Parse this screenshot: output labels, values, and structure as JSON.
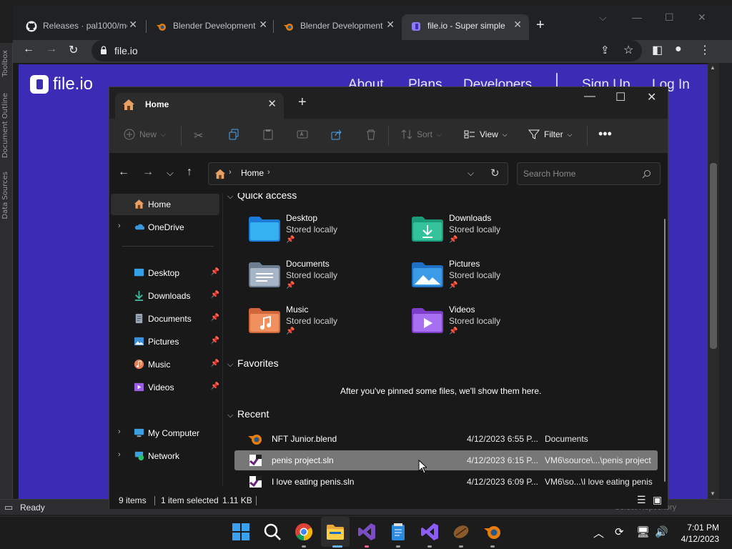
{
  "chrome": {
    "tabs": [
      {
        "title": "Releases · pal1000/me",
        "icon": "github-icon"
      },
      {
        "title": "Blender Development",
        "icon": "blender-icon"
      },
      {
        "title": "Blender Development",
        "icon": "blender-icon"
      },
      {
        "title": "file.io - Super simple",
        "icon": "fileio-icon",
        "active": true
      }
    ],
    "url": "file.io"
  },
  "fileio": {
    "brand": "file.io",
    "nav": [
      "About",
      "Plans",
      "Developers",
      "Sign Up",
      "Log In"
    ],
    "brand_color": "#3b2bb5"
  },
  "vs": {
    "side_labels": [
      "Toolbox",
      "Document Outline",
      "Data Sources"
    ],
    "status": "Ready",
    "status_right": "Select Repository"
  },
  "explorer": {
    "tab_title": "Home",
    "commands": {
      "new": "New",
      "sort": "Sort",
      "view": "View",
      "filter": "Filter"
    },
    "address": "Home",
    "search_placeholder": "Search Home",
    "nav": {
      "home": "Home",
      "onedrive": "OneDrive",
      "desktop": "Desktop",
      "downloads": "Downloads",
      "documents": "Documents",
      "pictures": "Pictures",
      "music": "Music",
      "videos": "Videos",
      "mycomputer": "My Computer",
      "network": "Network"
    },
    "quick_access_header": "Quick access",
    "quick_access": [
      {
        "name": "Desktop",
        "status": "Stored locally",
        "icon": "desktop-folder-icon"
      },
      {
        "name": "Downloads",
        "status": "Stored locally",
        "icon": "downloads-folder-icon"
      },
      {
        "name": "Documents",
        "status": "Stored locally",
        "icon": "documents-folder-icon"
      },
      {
        "name": "Pictures",
        "status": "Stored locally",
        "icon": "pictures-folder-icon"
      },
      {
        "name": "Music",
        "status": "Stored locally",
        "icon": "music-folder-icon"
      },
      {
        "name": "Videos",
        "status": "Stored locally",
        "icon": "videos-folder-icon"
      }
    ],
    "favorites_header": "Favorites",
    "favorites_empty": "After you've pinned some files, we'll show them here.",
    "recent_header": "Recent",
    "recent": [
      {
        "name": "NFT Junior.blend",
        "date": "4/12/2023 6:55 P...",
        "location": "Documents",
        "icon": "blender-file-icon"
      },
      {
        "name": "penis project.sln",
        "date": "4/12/2023 6:15 P...",
        "location": "VM6\\source\\...\\penis project",
        "icon": "vs-solution-icon",
        "selected": true
      },
      {
        "name": "I love eating penis.sln",
        "date": "4/12/2023 6:09 P...",
        "location": "VM6\\so...\\I love eating penis",
        "icon": "vs-solution-icon"
      }
    ],
    "status": {
      "items": "9 items",
      "selected": "1 item selected",
      "size": "1.11 KB"
    }
  },
  "taskbar": {
    "apps": [
      "windows-start-icon",
      "search-icon",
      "chrome-icon",
      "file-explorer-icon",
      "visual-studio-icon",
      "notepad-icon",
      "visual-studio-icon",
      "coffee-app-icon",
      "blender-icon"
    ],
    "time": "7:01 PM",
    "date": "4/12/2023"
  }
}
